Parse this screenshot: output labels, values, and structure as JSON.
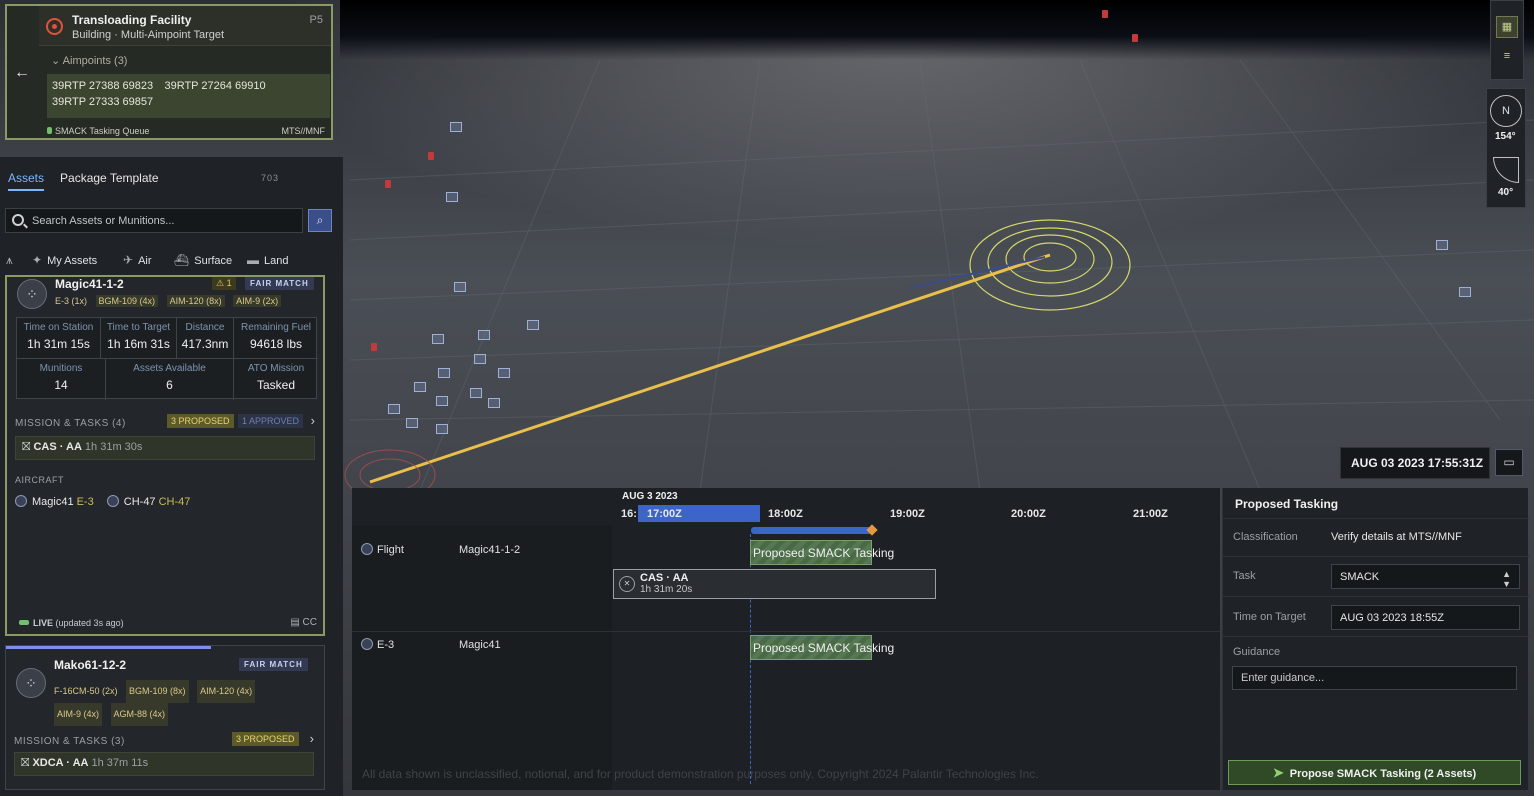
{
  "target": {
    "title": "Transloading Facility",
    "subtitle": "Building · Multi-Aimpoint Target",
    "priority": "P5",
    "aimpoints_label": "Aimpoints (3)",
    "aimpoints": [
      "39RTP 27388 69823",
      "39RTP 27264 69910",
      "39RTP 27333 69857"
    ],
    "queue": "SMACK Tasking Queue",
    "classification": "MTS//MNF"
  },
  "tabs": {
    "assets": "Assets",
    "package": "Package Template",
    "count": "703"
  },
  "search": {
    "placeholder": "Search Assets or Munitions..."
  },
  "filters": {
    "my_assets": "My Assets",
    "air": "Air",
    "surface": "Surface",
    "land": "Land"
  },
  "asset1": {
    "name": "Magic41-1-2",
    "warn": "⚠ 1",
    "fair": "FAIR MATCH",
    "munitions": [
      "E-3 (1x)",
      "BGM-109 (4x)",
      "AIM-120 (8x)",
      "AIM-9 (2x)"
    ],
    "stats": {
      "tos_label": "Time on Station",
      "tos_val": "1h 31m 15s",
      "ttt_label": "Time to Target",
      "ttt_val": "1h 16m 31s",
      "dist_label": "Distance",
      "dist_val": "417.3nm",
      "fuel_label": "Remaining Fuel",
      "fuel_val": "94618 lbs",
      "mun_label": "Munitions",
      "mun_val": "14",
      "avail_label": "Assets Available",
      "avail_val": "6",
      "ato_label": "ATO Mission",
      "ato_val": "Tasked"
    },
    "mission_label": "MISSION & TASKS (4)",
    "proposed": "3 PROPOSED",
    "approved": "1 APPROVED",
    "task": {
      "name": "CAS · AA",
      "time": "1h 31m 30s"
    },
    "aircraft_label": "AIRCRAFT",
    "aircraft": [
      {
        "name": "Magic41",
        "type": "E-3"
      },
      {
        "name": "CH-47",
        "type": "CH-47"
      }
    ],
    "live": "LIVE",
    "live_note": "(updated 3s ago)",
    "cc": "CC"
  },
  "asset2": {
    "name": "Mako61-12-2",
    "fair": "FAIR MATCH",
    "munitions": [
      "F-16CM-50 (2x)",
      "BGM-109 (8x)",
      "AIM-120 (4x)",
      "AIM-9 (4x)",
      "AGM-88 (4x)"
    ],
    "mission_label": "MISSION & TASKS (3)",
    "proposed": "3 PROPOSED",
    "task": {
      "name": "XDCA · AA",
      "time": "1h 37m 11s"
    }
  },
  "map_controls": {
    "heading": "154°",
    "tilt": "40°"
  },
  "datetime": "AUG 03 2023  17:55:31Z",
  "timeline": {
    "date": "AUG 3 2023",
    "ticks": [
      "16:",
      "17:00Z",
      "18:00Z",
      "19:00Z",
      "20:00Z",
      "21:00Z"
    ],
    "rows": [
      {
        "type": "Flight",
        "name": "Magic41-1-2"
      },
      {
        "type": "E-3",
        "name": "Magic41"
      }
    ],
    "proposed_label": "Proposed SMACK Tasking",
    "cas": {
      "title": "CAS · AA",
      "time": "1h 31m 20s"
    },
    "disclaimer": "All data shown is unclassified, notional, and for product demonstration purposes only. Copyright 2024 Palantir Technologies Inc."
  },
  "proposed_tasking": {
    "title": "Proposed Tasking",
    "classification_label": "Classification",
    "classification_val": "Verify details at MTS//MNF",
    "task_label": "Task",
    "task_val": "SMACK",
    "tot_label": "Time on Target",
    "tot_val": "AUG 03 2023 18:55Z",
    "guidance_label": "Guidance",
    "guidance_placeholder": "Enter guidance...",
    "submit": "Propose SMACK Tasking (2 Assets)"
  },
  "colors": {
    "accent": "#3c64c9",
    "proposed": "#557852",
    "warning": "#e8c85a",
    "target_red": "#e0523b"
  }
}
